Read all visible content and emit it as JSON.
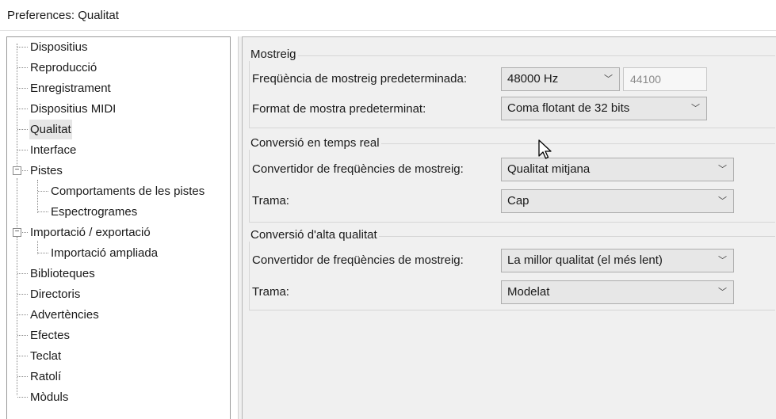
{
  "window": {
    "title": "Preferences: Qualitat"
  },
  "tree": {
    "items": [
      {
        "label": "Dispositius"
      },
      {
        "label": "Reproducció"
      },
      {
        "label": "Enregistrament"
      },
      {
        "label": "Dispositius MIDI"
      },
      {
        "label": "Qualitat",
        "selected": true
      },
      {
        "label": "Interface"
      },
      {
        "label": "Pistes",
        "expanded": true
      },
      {
        "label": "Comportaments de les pistes"
      },
      {
        "label": "Espectrogrames"
      },
      {
        "label": "Importació / exportació",
        "expanded": true
      },
      {
        "label": "Importació ampliada"
      },
      {
        "label": "Biblioteques"
      },
      {
        "label": "Directoris"
      },
      {
        "label": "Advertències"
      },
      {
        "label": "Efectes"
      },
      {
        "label": "Teclat"
      },
      {
        "label": "Ratolí"
      },
      {
        "label": "Mòduls"
      }
    ]
  },
  "sampling": {
    "title": "Mostreig",
    "rate_label": "Freqüència de mostreig predeterminada:",
    "rate_value": "48000 Hz",
    "rate_custom": "44100",
    "format_label": "Format de mostra predeterminat:",
    "format_value": "Coma flotant de 32 bits"
  },
  "realtime": {
    "title": "Conversió en temps real",
    "converter_label": "Convertidor de freqüències de mostreig:",
    "converter_value": "Qualitat mitjana",
    "dither_label": "Trama:",
    "dither_value": "Cap"
  },
  "highquality": {
    "title": "Conversió d'alta qualitat",
    "converter_label": "Convertidor de freqüències de mostreig:",
    "converter_value": "La millor qualitat (el més lent)",
    "dither_label": "Trama:",
    "dither_value": "Modelat"
  }
}
